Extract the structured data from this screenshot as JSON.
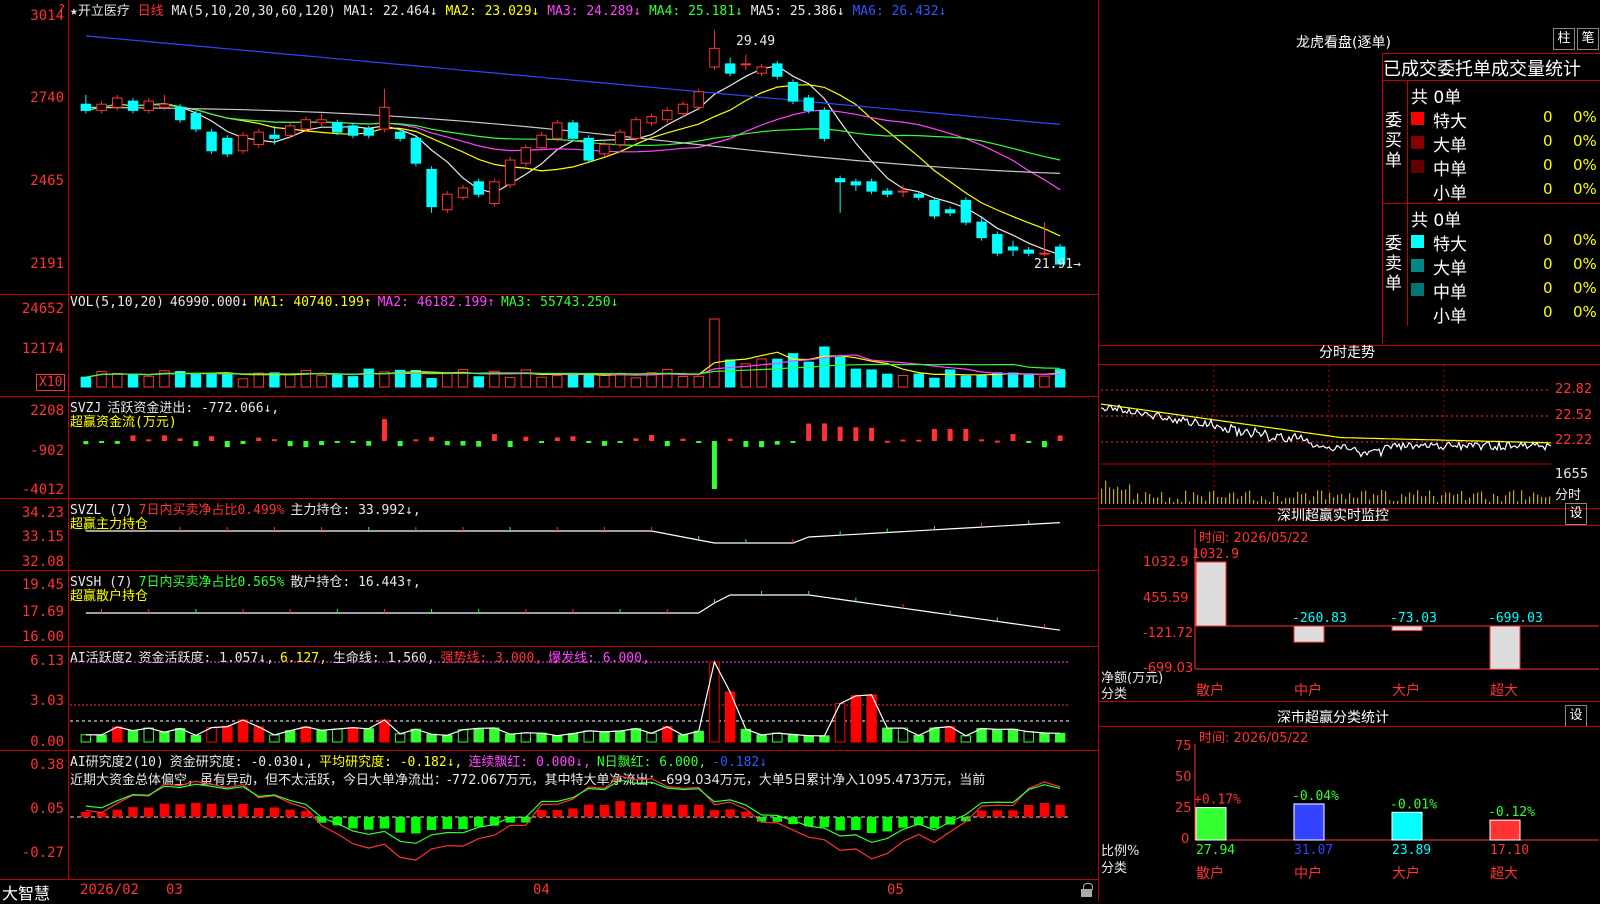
{
  "stock": {
    "star": "★",
    "name": "开立医疗",
    "period": "日线"
  },
  "kline": {
    "ma_header": "MA(5,10,20,30,60,120)",
    "ma": [
      {
        "label": "MA1: 22.464↓",
        "color": "#e8e8e8"
      },
      {
        "label": "MA2: 23.029↓",
        "color": "#ffff00"
      },
      {
        "label": "MA3: 24.289↓",
        "color": "#ff44ff"
      },
      {
        "label": "MA4: 25.181↓",
        "color": "#33ff33"
      },
      {
        "label": "MA5: 25.386↓",
        "color": "#e8e8e8"
      },
      {
        "label": "MA6: 26.432↓",
        "color": "#3355ff"
      }
    ],
    "yticks": [
      "3014",
      "2740",
      "2465",
      "2191"
    ],
    "high_label": "29.49",
    "low_label": "21.91→",
    "high": 29.49,
    "low": 21.91,
    "ymin": 21.5,
    "ymax": 30.2,
    "candles": [
      [
        27.1,
        26.9,
        27.4,
        26.8
      ],
      [
        26.9,
        27.1,
        27.2,
        26.8
      ],
      [
        27.0,
        27.3,
        27.4,
        26.9
      ],
      [
        27.2,
        26.9,
        27.3,
        26.8
      ],
      [
        26.9,
        27.2,
        27.3,
        26.8
      ],
      [
        27.0,
        27.1,
        27.4,
        26.9
      ],
      [
        27.0,
        26.6,
        27.1,
        26.5
      ],
      [
        26.8,
        26.3,
        26.9,
        26.2
      ],
      [
        26.2,
        25.6,
        26.3,
        25.5
      ],
      [
        26.0,
        25.5,
        26.1,
        25.4
      ],
      [
        25.6,
        26.1,
        26.2,
        25.5
      ],
      [
        25.8,
        26.2,
        26.3,
        25.7
      ],
      [
        26.1,
        26.0,
        26.4,
        25.8
      ],
      [
        26.1,
        26.4,
        26.5,
        26.0
      ],
      [
        26.3,
        26.6,
        26.7,
        26.2
      ],
      [
        26.5,
        26.6,
        26.8,
        26.4
      ],
      [
        26.5,
        26.2,
        26.6,
        26.1
      ],
      [
        26.4,
        26.1,
        26.5,
        26.0
      ],
      [
        26.3,
        26.1,
        26.4,
        26.0
      ],
      [
        26.3,
        27.0,
        27.6,
        26.2
      ],
      [
        26.2,
        26.0,
        26.3,
        25.9
      ],
      [
        26.0,
        25.2,
        26.1,
        25.1
      ],
      [
        25.0,
        23.8,
        25.1,
        23.6
      ],
      [
        23.7,
        24.2,
        24.3,
        23.6
      ],
      [
        24.1,
        24.4,
        24.5,
        24.0
      ],
      [
        24.6,
        24.2,
        24.7,
        24.1
      ],
      [
        23.9,
        24.6,
        24.7,
        23.8
      ],
      [
        24.5,
        25.3,
        25.4,
        24.4
      ],
      [
        25.2,
        25.7,
        25.8,
        25.1
      ],
      [
        25.7,
        26.1,
        26.2,
        25.6
      ],
      [
        26.0,
        26.5,
        26.6,
        25.9
      ],
      [
        26.5,
        26.0,
        26.6,
        25.9
      ],
      [
        26.0,
        25.3,
        26.1,
        25.2
      ],
      [
        25.5,
        25.8,
        25.9,
        25.4
      ],
      [
        25.8,
        26.2,
        26.3,
        25.7
      ],
      [
        26.0,
        26.6,
        26.7,
        25.9
      ],
      [
        26.5,
        26.7,
        26.8,
        26.4
      ],
      [
        26.6,
        26.9,
        27.0,
        26.5
      ],
      [
        26.8,
        27.1,
        27.2,
        26.7
      ],
      [
        27.0,
        27.5,
        27.6,
        26.9
      ],
      [
        28.3,
        28.9,
        29.5,
        28.2
      ],
      [
        28.4,
        28.1,
        28.6,
        28.0
      ],
      [
        28.4,
        28.4,
        28.7,
        28.2
      ],
      [
        28.1,
        28.3,
        28.4,
        28.0
      ],
      [
        28.4,
        28.0,
        28.5,
        27.9
      ],
      [
        27.8,
        27.2,
        27.9,
        27.1
      ],
      [
        27.3,
        26.9,
        27.4,
        26.8
      ],
      [
        26.9,
        26.0,
        27.0,
        25.9
      ],
      [
        24.7,
        24.6,
        24.8,
        23.6
      ],
      [
        24.6,
        24.5,
        24.7,
        24.3
      ],
      [
        24.6,
        24.3,
        24.7,
        24.2
      ],
      [
        24.3,
        24.2,
        24.4,
        24.1
      ],
      [
        24.3,
        24.3,
        24.5,
        24.1
      ],
      [
        24.2,
        24.1,
        24.3,
        24.0
      ],
      [
        24.0,
        23.5,
        24.1,
        23.4
      ],
      [
        23.7,
        23.6,
        23.8,
        23.5
      ],
      [
        24.0,
        23.3,
        24.1,
        23.2
      ],
      [
        23.3,
        22.8,
        23.5,
        22.7
      ],
      [
        22.9,
        22.3,
        23.0,
        22.2
      ],
      [
        22.5,
        22.4,
        22.7,
        22.2
      ],
      [
        22.4,
        22.3,
        22.5,
        22.2
      ],
      [
        22.3,
        22.3,
        23.3,
        22.2
      ],
      [
        22.5,
        21.95,
        22.6,
        21.9
      ]
    ]
  },
  "vol": {
    "header": "VOL(5,10,20)",
    "value": "46990.000↓",
    "ma": [
      {
        "label": "MA1: 40740.199↑",
        "color": "#ffff00"
      },
      {
        "label": "MA2: 46182.199↑",
        "color": "#ff44ff"
      },
      {
        "label": "MA3: 55743.250↓",
        "color": "#33ff33"
      }
    ],
    "yticks": [
      "24652",
      "12174"
    ],
    "unit": "X10"
  },
  "svzj": {
    "header": "SVZJ",
    "sub": "活跃资金进出: -772.066↓,",
    "title": "超赢资金流(万元)",
    "yticks": [
      "2208",
      "-902",
      "-4012"
    ]
  },
  "svzl": {
    "header": "SVZL (7)",
    "ratio": "7日内买卖净占比0.499%",
    "hold": "主力持仓: 33.992↓,",
    "title": "超赢主力持仓",
    "yticks": [
      "34.23",
      "33.15",
      "32.08"
    ]
  },
  "svsh": {
    "header": "SVSH (7)",
    "ratio": "7日内买卖净占比0.565%",
    "hold": "散户持仓: 16.443↑,",
    "title": "超赢散户持仓",
    "yticks": [
      "19.45",
      "17.69",
      "16.00"
    ]
  },
  "ai1": {
    "header": "AI活跃度2",
    "a": "资金活跃度: 1.057↓,",
    "b": "6.127,",
    "c": "生命线: 1.560,",
    "d": "强势线: 3.000,",
    "e": "爆发线: 6.000,",
    "yticks": [
      "6.13",
      "3.03",
      "0.00"
    ]
  },
  "ai2": {
    "header": "AI研究度2(10)",
    "a": "资金研究度: -0.030↓,",
    "b": "平均研究度: -0.182↓,",
    "c": "连续飘红: 0.000↓,",
    "d": "N日飘红: 6.000,",
    "e": "-0.182↓",
    "note": "近期大资金总体偏空，虽有异动，但不太活跃，今日大单净流出：-772.067万元，其中特大单净流出：-699.034万元，大单5日累计净入1095.473万元，当前",
    "yticks": [
      "0.38",
      "0.05",
      "-0.27"
    ]
  },
  "bottom": {
    "brand": "大智慧",
    "date": "2026/02",
    "months": [
      "03",
      "04",
      "05"
    ]
  },
  "dragon": {
    "title": "龙虎看盘(逐单)",
    "btn1": "柱",
    "btn2": "笔",
    "stat_title": "已成交委托单成交量统计",
    "buy": {
      "label": "委买单",
      "total": "共 0单",
      "rows": [
        {
          "name": "特大",
          "count": "0",
          "pct": "0%",
          "color": "#ff0000"
        },
        {
          "name": "大单",
          "count": "0",
          "pct": "0%",
          "color": "#880000"
        },
        {
          "name": "中单",
          "count": "0",
          "pct": "0%",
          "color": "#660000"
        },
        {
          "name": "小单",
          "count": "0",
          "pct": "0%",
          "color": ""
        }
      ]
    },
    "sell": {
      "label": "委卖单",
      "total": "共 0单",
      "rows": [
        {
          "name": "特大",
          "count": "0",
          "pct": "0%",
          "color": "#00ffff"
        },
        {
          "name": "大单",
          "count": "0",
          "pct": "0%",
          "color": "#008888"
        },
        {
          "name": "中单",
          "count": "0",
          "pct": "0%",
          "color": "#007777"
        },
        {
          "name": "小单",
          "count": "0",
          "pct": "0%",
          "color": ""
        }
      ]
    }
  },
  "intraday": {
    "title": "分时走势",
    "yticks": [
      "22.82",
      "22.52",
      "22.22"
    ],
    "vol_tick": "1655",
    "vol_label": "分时"
  },
  "sz_monitor": {
    "title": "深圳超赢实时监控",
    "btn": "设",
    "time": "时间: 2026/05/22",
    "yticks": [
      "1032.9",
      "455.59",
      "-121.72",
      "-699.03"
    ],
    "ylabel1": "净额(万元)",
    "ylabel2": "分类",
    "cats": [
      "散户",
      "中户",
      "大户",
      "超大"
    ],
    "values": [
      1032.9,
      -260.83,
      -73.03,
      -699.03
    ],
    "value_labels": [
      "1032.9",
      "-260.83",
      "-73.03",
      "-699.03"
    ]
  },
  "sz_stats": {
    "title": "深市超赢分类统计",
    "btn": "设",
    "time": "时间: 2026/05/22",
    "yticks": [
      "75",
      "50",
      "25",
      "0"
    ],
    "ylabel1": "比例%",
    "ylabel2": "分类",
    "cats": [
      "散户",
      "中户",
      "大户",
      "超大"
    ],
    "values": [
      27.94,
      31.07,
      23.89,
      17.1
    ],
    "value_labels": [
      "27.94",
      "31.07",
      "23.89",
      "17.10"
    ],
    "changes": [
      "+0.17%",
      "-0.04%",
      "-0.01%",
      "-0.12%"
    ],
    "colors": [
      "#33ff33",
      "#3344ff",
      "#00ffff",
      "#ff3333"
    ]
  }
}
